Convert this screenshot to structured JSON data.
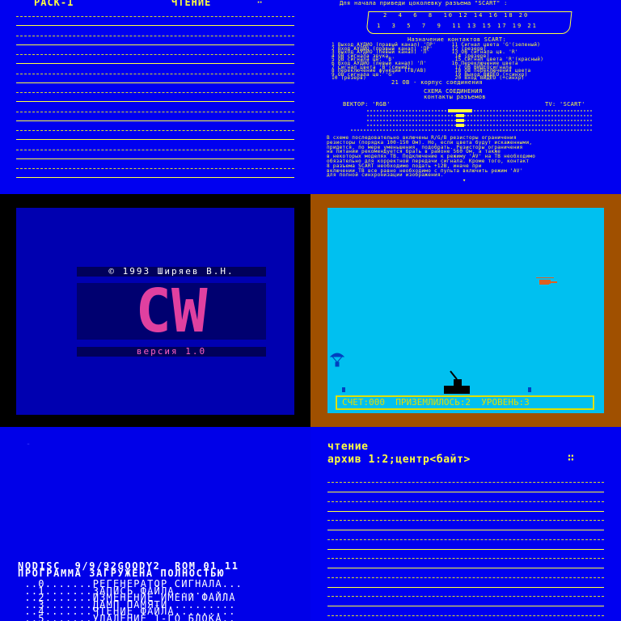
{
  "panel_tl": {
    "left_title": "PACK-1",
    "right_title": "ЧТЕНИЕ"
  },
  "panel_tr": {
    "top_line": "Для начала приведи цоколевку разъема \"SCART\" :",
    "pins_top": "2  4  6  8  10 12 14 16 18 20",
    "pins_bottom": "1  3  5  7  9  11 13 15 17 19 21",
    "table_title": "Назначение контактов SCART:",
    "table_rows": [
      "1 Выход АУДИО (правый канал) 'ПР'     11 Сигнал цвета 'G'(зеленый)",
      "2 Вход АУДИО (правый канал) 'ПР'      12 (резерв)",
      "3 Выход АУДИО (левый канал) 'Л'       13 ОВ сигнала цв. 'R'",
      "4 ОВ сигнала звука                     14 (резерв)",
      "5 ОВ сигнала цв. 'B'                   15 Сигнал цвета 'R'(красный)",
      "6 Вход АУДИО (левый канал) 'Л'        16 Переключение цвета",
      "7 Сигнал цвета 'B'(синий)              17 ОВ ВИДЕОсигнала",
      "8 Переключение функций (ТВ/АВ)         18 ОВ переключения цвета",
      "9 ОВ сигнала цв. 'G'                   19 Выход ВИДЕО (+синхр)",
      "10 (резерв)                            20 Вход ВИДЕО (+синхр)"
    ],
    "note": "21 ОВ - корпус соединения",
    "scheme_title": "СХЕМА СОЕДИНЕНИЯ",
    "scheme_sub": "контакты разъемов",
    "vector_label": "ВЕКТОР: 'RGB'",
    "tv_label": "TV: 'SCART'",
    "paragraph": [
      "В схеме последовательно включены R/G/B резисторы ограничения",
      "резисторы (порядка 100-150 Ом). Но, если цвета будут искаженными,",
      "придется, по мере уменьшения, подобрать. Резисторы ограничения",
      "на питании рекомендуется брать в районе 560 Ом, а также",
      "в некоторых моделях ТВ. Подключение к режиму 'AV' на ТВ необходимо",
      "обязательно для корректной передачи сигнала. Кроме того, контакт",
      "8 разъема SCART необходимо подать +12В, иначе при",
      "включении ТВ все равно необходимо с пульта включить режим 'AV'",
      "для полной синхронизации изображения."
    ]
  },
  "panel_ml": {
    "copyright": "© 1993 Ширяев В.Н.",
    "logo": "CW",
    "version": "версия 1.0"
  },
  "panel_mr": {
    "score_label": "СЧЕТ:000",
    "landed_label": "ПРИЗЕМЛИЛОСЬ:2",
    "level_label": "УРОВЕНЬ:3"
  },
  "panel_bl": {
    "status_line": "NODISC  9/9/92GOODY2  ROM 01 11",
    "loaded_line": "ПРОГРАММА ЗАГРУЖЕНА ПОЛНОСТЬЮ",
    "menu": [
      {
        "key": "0",
        "label": "РЕГЕНЕРАТОР СИГНАЛА..."
      },
      {
        "key": "1",
        "label": "ЗАПИСЬ ФАЙЛА........."
      },
      {
        "key": "2",
        "label": "ИЗМЕНЕНИЕ ИМЕНИ ФАЙЛА"
      },
      {
        "key": "3",
        "label": "ДАМП ПАМЯТИ.........."
      },
      {
        "key": "4",
        "label": "ЧТЕНИЕ ФАЙЛА........."
      },
      {
        "key": "5",
        "label": "УДАЛЕНИЕ 1-ГО БЛОКА.."
      }
    ]
  },
  "panel_br": {
    "title": "чтение",
    "subtitle": "архив 1:2;центр<байт>"
  },
  "colors": {
    "blue": "#0000f0",
    "yellow": "#ffff40",
    "magenta": "#e040a0",
    "sky": "#00c0f0",
    "brown": "#a05000"
  }
}
